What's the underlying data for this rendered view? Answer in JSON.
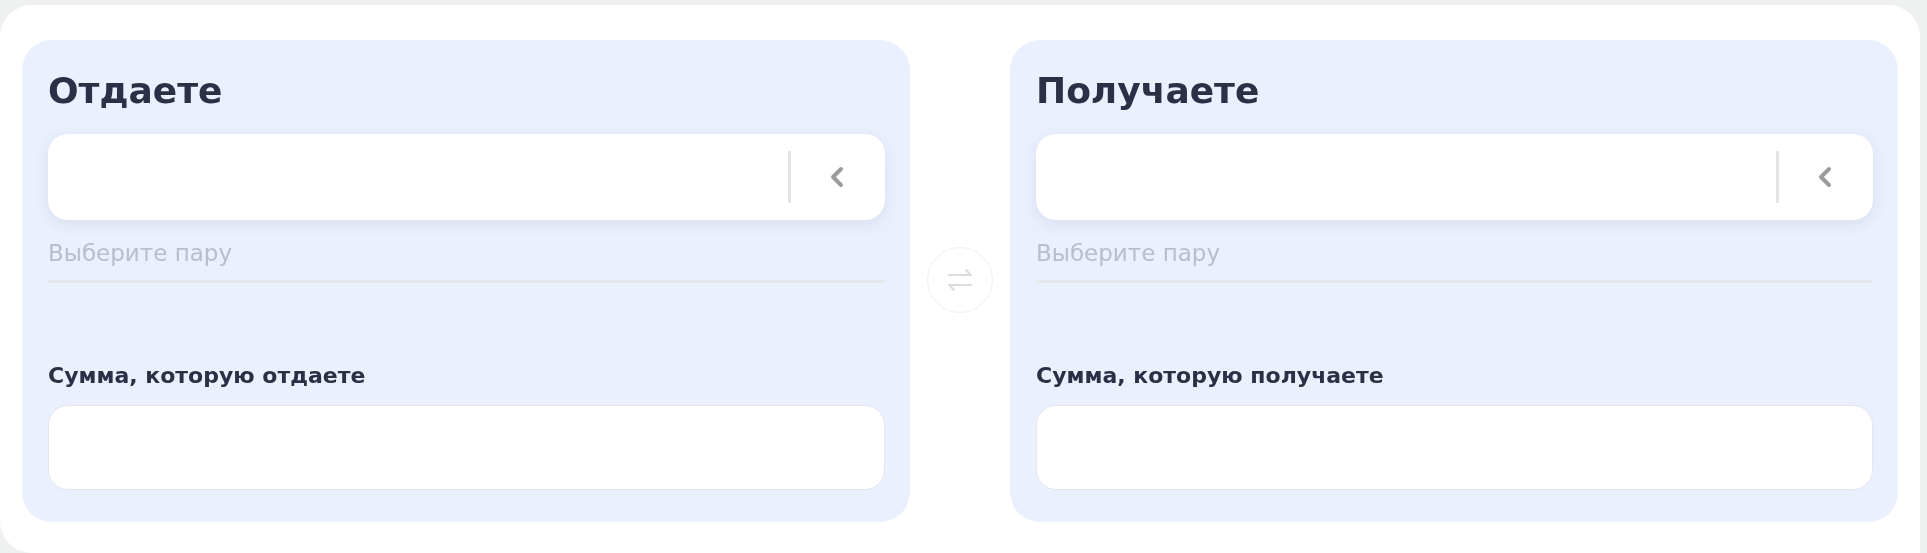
{
  "sides": [
    {
      "title": "Отдаете",
      "pair_field": {
        "placeholder": "Выберите пару"
      },
      "amount_label": "Сумма, которую отдаете"
    },
    {
      "title": "Получаете",
      "pair_field": {
        "placeholder": "Выберите пару"
      },
      "amount_label": "Сумма, которую получаете"
    }
  ],
  "swap_button": {
    "disabled": true
  }
}
